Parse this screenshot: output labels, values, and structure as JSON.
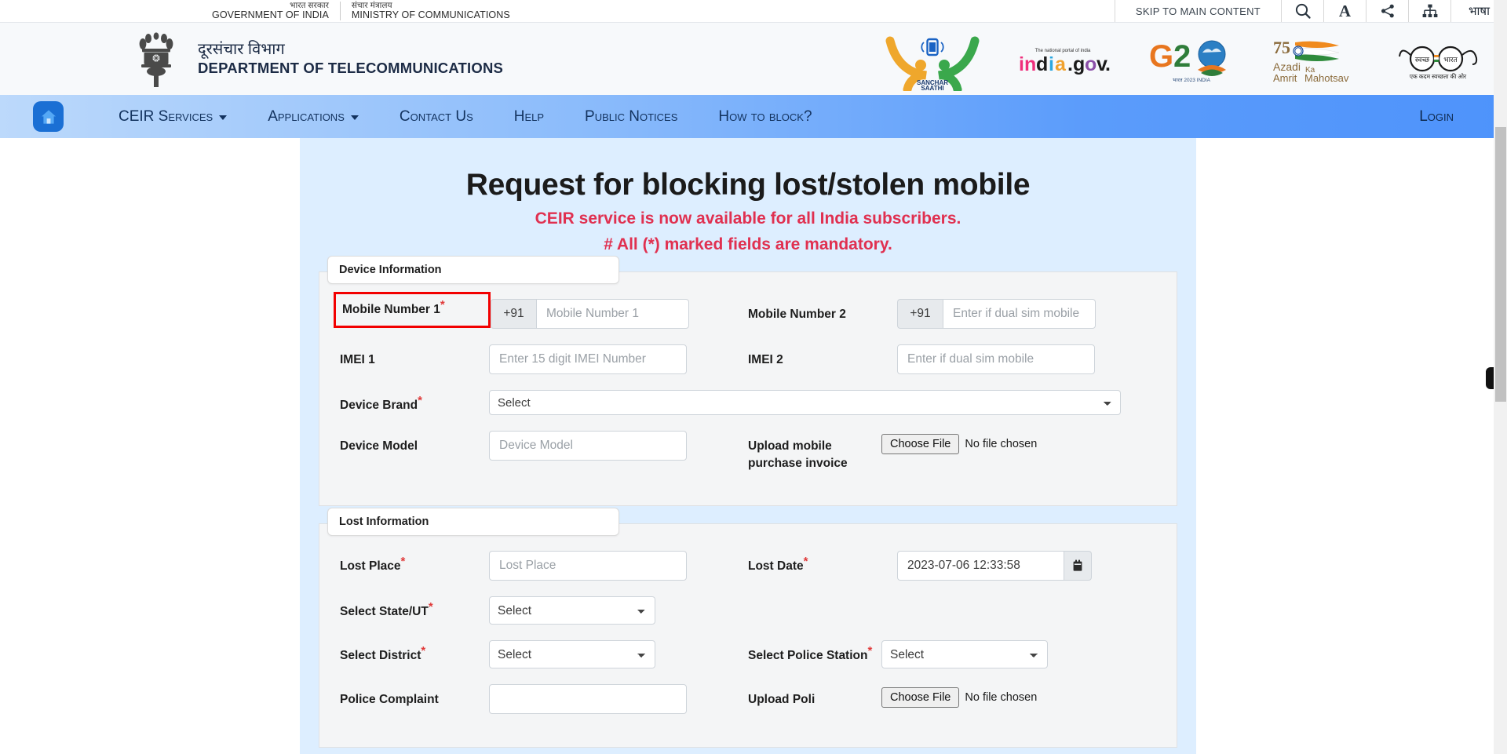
{
  "topbar": {
    "gov_hi": "भारत सरकार",
    "gov_en": "GOVERNMENT OF INDIA",
    "ministry_hi": "संचार मंत्रालय",
    "ministry_en": "MINISTRY OF COMMUNICATIONS",
    "skip_link": "SKIP TO MAIN CONTENT",
    "icons": [
      "search-icon",
      "font-size-icon",
      "share-icon",
      "sitemap-icon"
    ],
    "font_size_label": "A",
    "language_label": "भाषा"
  },
  "header": {
    "emblem_alt": "national-emblem-of-india",
    "dept_hi": "दूरसंचार विभाग",
    "dept_en": "DEPARTMENT OF TELECOMMUNICATIONS",
    "logos": [
      {
        "name": "sanchar-saathi-logo",
        "caption": "SANCHAR SAATHI"
      },
      {
        "name": "india-gov-in-logo",
        "tagline": "The national portal of india",
        "text": "india.gov.in"
      },
      {
        "name": "g20-india-logo",
        "text": "G20"
      },
      {
        "name": "azadi-ka-amrit-mahotsav-logo",
        "text75": "75",
        "line1": "Azadi Ka",
        "line2": "Amrit Mahotsav"
      },
      {
        "name": "swachh-bharat-logo",
        "left": "स्वच्छ",
        "right": "भारत",
        "caption": "एक कदम स्वच्छता की ओर"
      }
    ]
  },
  "nav": {
    "home_icon": "home-icon",
    "items": [
      {
        "label": "CEIR Services",
        "has_dropdown": true
      },
      {
        "label": "Applications",
        "has_dropdown": true
      },
      {
        "label": "Contact Us",
        "has_dropdown": false
      },
      {
        "label": "Help",
        "has_dropdown": false
      },
      {
        "label": "Public Notices",
        "has_dropdown": false
      },
      {
        "label": "How to block?",
        "has_dropdown": false
      }
    ],
    "login_label": "Login"
  },
  "main": {
    "title": "Request for blocking lost/stolen mobile",
    "subtitle_1": "CEIR service is now available for all India subscribers.",
    "subtitle_2": "# All (*) marked fields are mandatory.",
    "accent_red": "#e03050",
    "highlight_red": "#f20000"
  },
  "device_section": {
    "legend": "Device Information",
    "mobile1": {
      "label": "Mobile Number 1",
      "required": "*",
      "prefix": "+91",
      "placeholder": "Mobile Number 1",
      "value": "",
      "highlighted": true
    },
    "mobile2": {
      "label": "Mobile Number 2",
      "prefix": "+91",
      "placeholder": "Enter if dual sim mobile",
      "value": ""
    },
    "imei1": {
      "label": "IMEI 1",
      "placeholder": "Enter 15 digit IMEI Number",
      "value": ""
    },
    "imei2": {
      "label": "IMEI 2",
      "placeholder": "Enter if dual sim mobile",
      "value": ""
    },
    "device_brand": {
      "label": "Device Brand",
      "required": "*",
      "selected": "Select",
      "options": [
        "Select"
      ]
    },
    "device_model": {
      "label": "Device Model",
      "placeholder": "Device Model",
      "value": ""
    },
    "upload_invoice": {
      "label": "Upload mobile purchase invoice",
      "button": "Choose File",
      "status": "No file chosen"
    }
  },
  "lost_section": {
    "legend": "Lost Information",
    "lost_place": {
      "label": "Lost Place",
      "required": "*",
      "placeholder": "Lost Place",
      "value": ""
    },
    "lost_date": {
      "label": "Lost Date",
      "required": "*",
      "value": "2023-07-06 12:33:58",
      "icon": "calendar-icon"
    },
    "state": {
      "label": "Select State/UT",
      "required": "*",
      "selected": "Select",
      "options": [
        "Select"
      ]
    },
    "district": {
      "label": "Select District",
      "required": "*",
      "selected": "Select",
      "options": [
        "Select"
      ]
    },
    "police_station": {
      "label": "Select Police Station",
      "required": "*",
      "selected": "Select",
      "options": [
        "Select"
      ]
    },
    "complaint": {
      "label": "Police Complaint",
      "placeholder": "",
      "value": ""
    },
    "upload_complaint": {
      "label": "Upload Poli",
      "button": "Choose File",
      "status": "No file chosen"
    }
  }
}
